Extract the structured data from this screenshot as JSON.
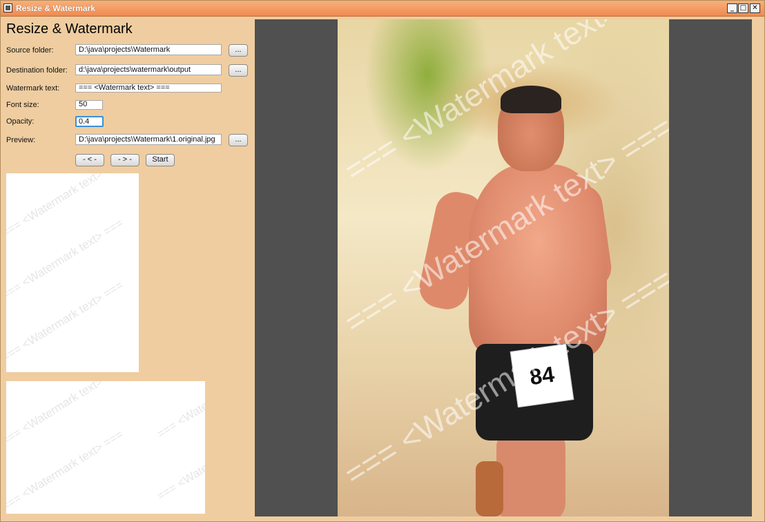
{
  "window": {
    "title": "Resize & Watermark",
    "min_label": "_",
    "max_label": "□",
    "close_label": "✕"
  },
  "heading": "Resize & Watermark",
  "fields": {
    "source_label": "Source folder:",
    "source_value": "D:\\java\\projects\\Watermark",
    "dest_label": "Destination folder:",
    "dest_value": "d:\\java\\projects\\watermark\\output",
    "wm_label": "Watermark text:",
    "wm_value": "=== <Watermark text> ===",
    "font_label": "Font size:",
    "font_value": "50",
    "opacity_label": "Opacity:",
    "opacity_value": "0.4",
    "preview_label": "Preview:",
    "preview_value": "D:\\java\\projects\\Watermark\\1.original.jpg"
  },
  "browse_label": "...",
  "buttons": {
    "prev": "- < -",
    "next": "- > -",
    "start": "Start"
  },
  "thumb_wm": "=== <Watermark text> ===",
  "photo": {
    "bib_number": "84",
    "watermark": "=== <Watermark text> ==="
  }
}
